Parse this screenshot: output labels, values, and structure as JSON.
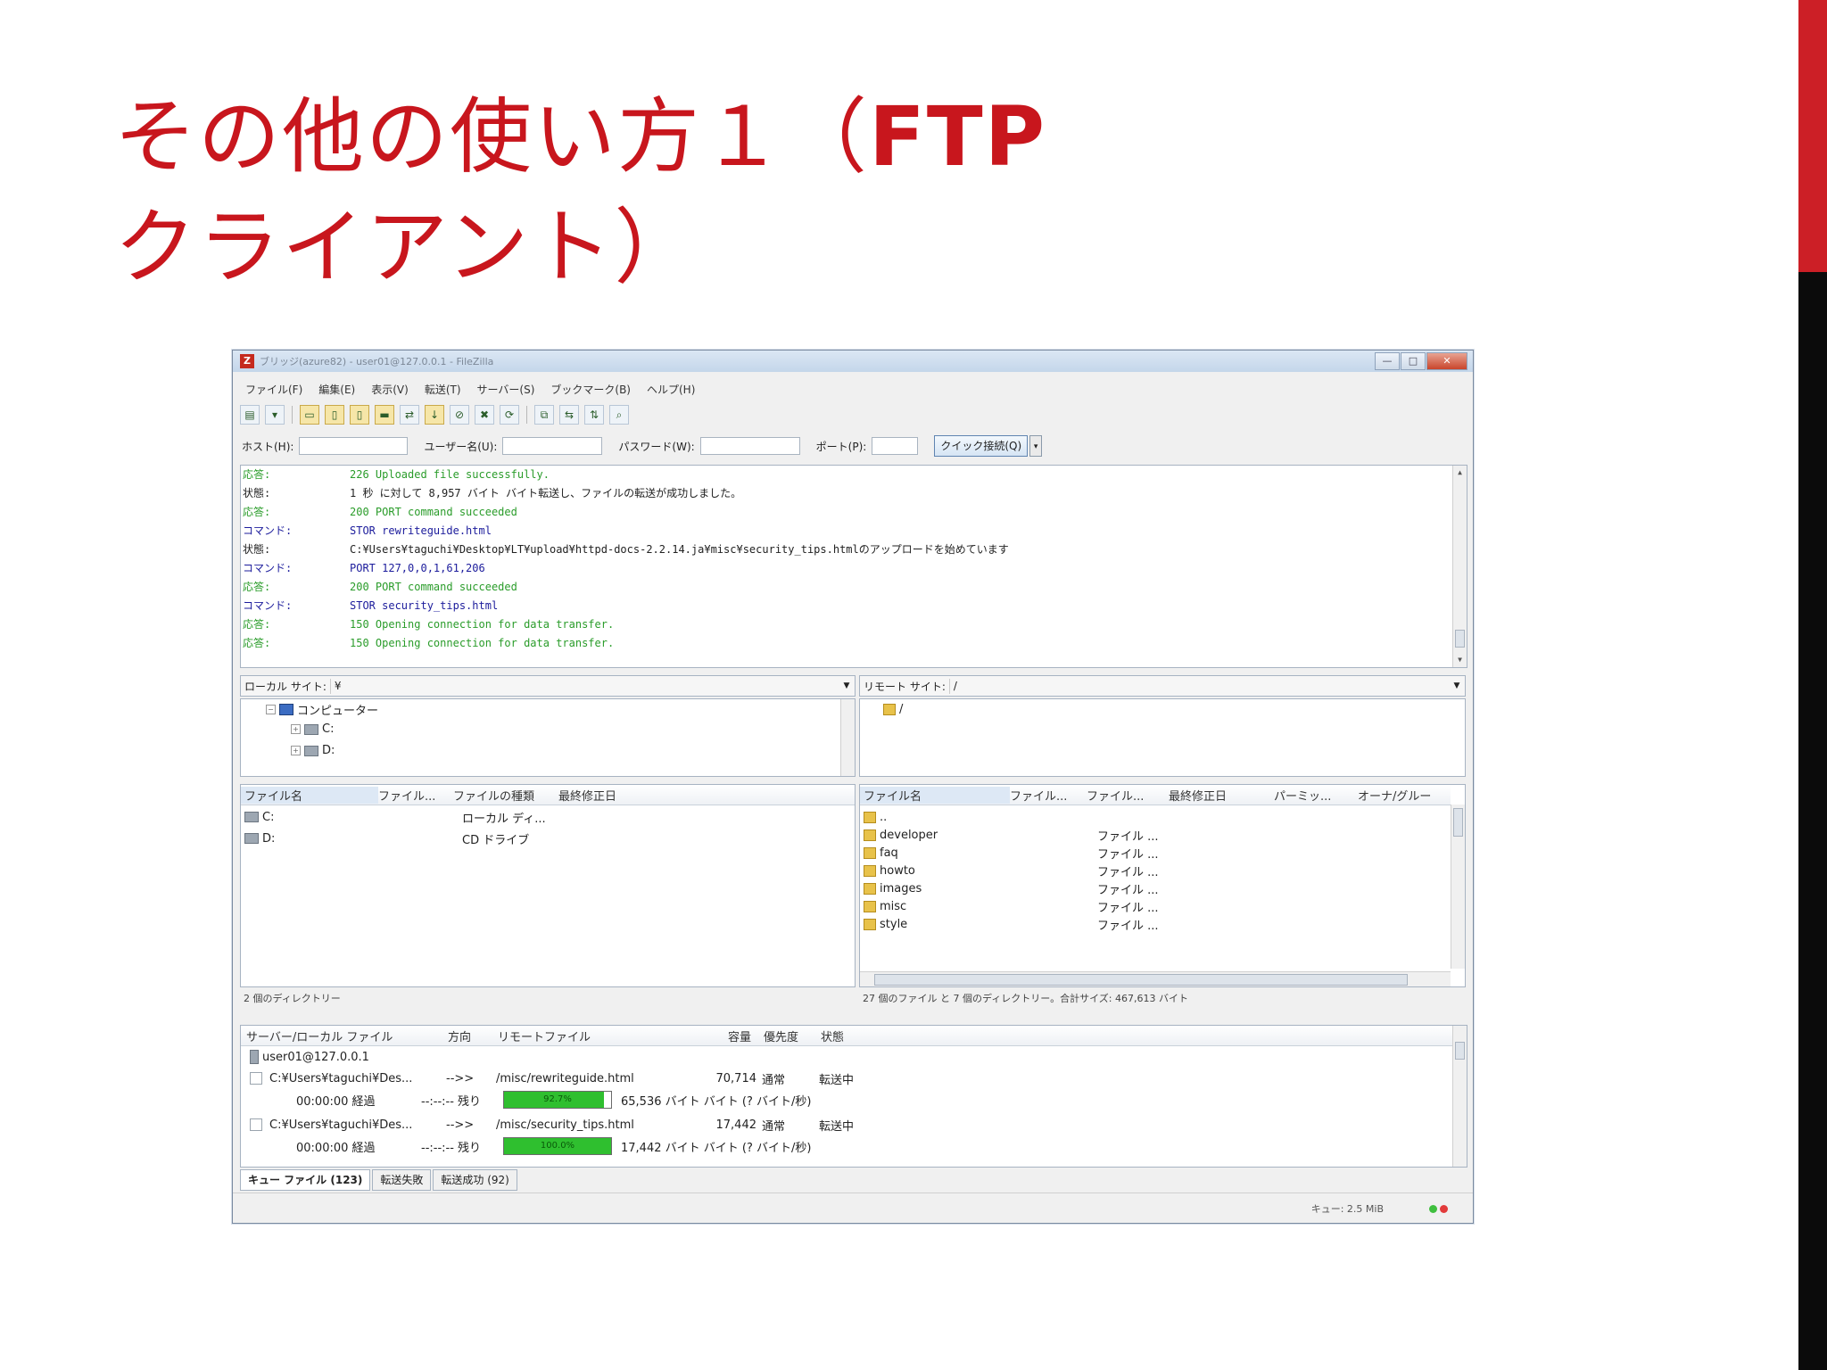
{
  "slide": {
    "title_part1": "その他の使い方１（",
    "title_bold": "FTP",
    "title_part2": "クライアント）"
  },
  "colors": {
    "title_red": "#c8161d",
    "progress_green": "#2fbf2f",
    "log_response": "#2a9c2a",
    "log_command": "#1c1c9c"
  },
  "window": {
    "title": "ブリッジ(azure82) - user01@127.0.0.1 - FileZilla",
    "controls": {
      "minimize": "—",
      "maximize": "□",
      "close": "✕"
    }
  },
  "menu": [
    "ファイル(F)",
    "編集(E)",
    "表示(V)",
    "転送(T)",
    "サーバー(S)",
    "ブックマーク(B)",
    "ヘルプ(H)"
  ],
  "quickconnect": {
    "host_label": "ホスト(H):",
    "user_label": "ユーザー名(U):",
    "password_label": "パスワード(W):",
    "port_label": "ポート(P):",
    "button": "クイック接続(Q)"
  },
  "log": [
    {
      "kind": "応答:",
      "msg": "226 Uploaded file successfully.",
      "type": "resp"
    },
    {
      "kind": "状態:",
      "msg": "1 秒 に対して 8,957 バイト バイト転送し、ファイルの転送が成功しました。",
      "type": "stat"
    },
    {
      "kind": "応答:",
      "msg": "200 PORT command succeeded",
      "type": "resp"
    },
    {
      "kind": "コマンド:",
      "msg": "STOR rewriteguide.html",
      "type": "cmd"
    },
    {
      "kind": "状態:",
      "msg": "C:¥Users¥taguchi¥Desktop¥LT¥upload¥httpd-docs-2.2.14.ja¥misc¥security_tips.htmlのアップロードを始めています",
      "type": "stat"
    },
    {
      "kind": "コマンド:",
      "msg": "PORT 127,0,0,1,61,206",
      "type": "cmd"
    },
    {
      "kind": "応答:",
      "msg": "200 PORT command succeeded",
      "type": "resp"
    },
    {
      "kind": "コマンド:",
      "msg": "STOR security_tips.html",
      "type": "cmd"
    },
    {
      "kind": "応答:",
      "msg": "150 Opening connection for data transfer.",
      "type": "resp"
    },
    {
      "kind": "応答:",
      "msg": "150 Opening connection for data transfer.",
      "type": "resp"
    }
  ],
  "local": {
    "site_label": "ローカル サイト:",
    "site_path": "¥",
    "tree": {
      "root": "コンピューター",
      "drives": [
        "C:",
        "D:"
      ]
    },
    "columns": [
      "ファイル名",
      "ファイル...",
      "ファイルの種類",
      "最終修正日"
    ],
    "files": [
      {
        "name": "C:",
        "type": "ローカル ディ..."
      },
      {
        "name": "D:",
        "type": "CD ドライブ"
      }
    ],
    "status": "2 個のディレクトリー"
  },
  "remote": {
    "site_label": "リモート サイト:",
    "site_path": "/",
    "tree_root": "/",
    "columns": [
      "ファイル名",
      "ファイル...",
      "ファイル...",
      "最終修正日",
      "パーミッ...",
      "オーナ/グルー"
    ],
    "files": [
      {
        "name": "..",
        "type": ""
      },
      {
        "name": "developer",
        "type": "ファイル ..."
      },
      {
        "name": "faq",
        "type": "ファイル ..."
      },
      {
        "name": "howto",
        "type": "ファイル ..."
      },
      {
        "name": "images",
        "type": "ファイル ..."
      },
      {
        "name": "misc",
        "type": "ファイル ..."
      },
      {
        "name": "style",
        "type": "ファイル ..."
      }
    ],
    "status": "27 個のファイル と 7 個のディレクトリー。合計サイズ: 467,613 バイト"
  },
  "queue": {
    "columns": [
      "サーバー/ローカル ファイル",
      "方向",
      "リモートファイル",
      "容量",
      "優先度",
      "状態"
    ],
    "server": "user01@127.0.0.1",
    "items": [
      {
        "local": "C:¥Users¥taguchi¥Des...",
        "dir": "-->>",
        "remote": "/misc/rewriteguide.html",
        "size": "70,714",
        "priority": "通常",
        "state": "転送中",
        "elapsed": "00:00:00 経過",
        "remaining": "--:--:-- 残り",
        "progress": 0.93,
        "progress_text": "92.7%",
        "bytes": "65,536 バイト バイト (? バイト/秒)"
      },
      {
        "local": "C:¥Users¥taguchi¥Des...",
        "dir": "-->>",
        "remote": "/misc/security_tips.html",
        "size": "17,442",
        "priority": "通常",
        "state": "転送中",
        "elapsed": "00:00:00 経過",
        "remaining": "--:--:-- 残り",
        "progress": 1.0,
        "progress_text": "100.0%",
        "bytes": "17,442 バイト バイト (? バイト/秒)"
      }
    ],
    "tabs": [
      "キュー ファイル (123)",
      "転送失敗",
      "転送成功 (92)"
    ]
  },
  "statusbar": {
    "queue": "キュー: 2.5 MiB"
  }
}
